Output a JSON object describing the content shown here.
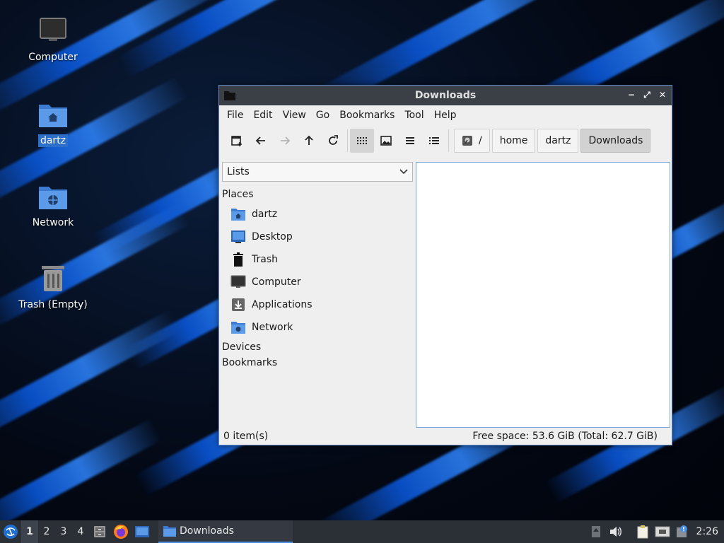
{
  "desktop": {
    "icons": [
      {
        "label": "Computer"
      },
      {
        "label": "dartz"
      },
      {
        "label": "Network"
      },
      {
        "label": "Trash (Empty)"
      }
    ]
  },
  "window": {
    "title": "Downloads",
    "controls": {
      "minimize": "−",
      "maximize": "⤢",
      "close": "✕"
    },
    "menu": [
      "File",
      "Edit",
      "View",
      "Go",
      "Bookmarks",
      "Tool",
      "Help"
    ],
    "toolbar": {
      "icons": [
        "new-tab-icon",
        "back-icon",
        "forward-icon",
        "up-icon",
        "reload-icon",
        "icon-view-icon",
        "thumbnail-view-icon",
        "compact-view-icon",
        "detailed-list-view-icon"
      ],
      "active_view": "icon-view"
    },
    "breadcrumbs": [
      "/",
      "home",
      "dartz",
      "Downloads"
    ],
    "sidebar": {
      "mode": "Lists",
      "sections": {
        "places": "Places",
        "devices": "Devices",
        "bookmarks": "Bookmarks"
      },
      "places": [
        {
          "label": "dartz",
          "icon": "home-folder-icon"
        },
        {
          "label": "Desktop",
          "icon": "desktop-icon"
        },
        {
          "label": "Trash",
          "icon": "trash-icon"
        },
        {
          "label": "Computer",
          "icon": "computer-icon"
        },
        {
          "label": "Applications",
          "icon": "applications-icon"
        },
        {
          "label": "Network",
          "icon": "network-folder-icon"
        }
      ]
    },
    "status": {
      "items": "0 item(s)",
      "free_space": "Free space: 53.6 GiB (Total: 62.7 GiB)"
    }
  },
  "taskbar": {
    "workspaces": [
      "1",
      "2",
      "3",
      "4"
    ],
    "active_workspace": "1",
    "task_label": "Downloads",
    "clock": "2:26"
  },
  "colors": {
    "accent": "#4a90e2",
    "titlebar": "#3b3f46",
    "taskbar": "#2b2f36"
  }
}
